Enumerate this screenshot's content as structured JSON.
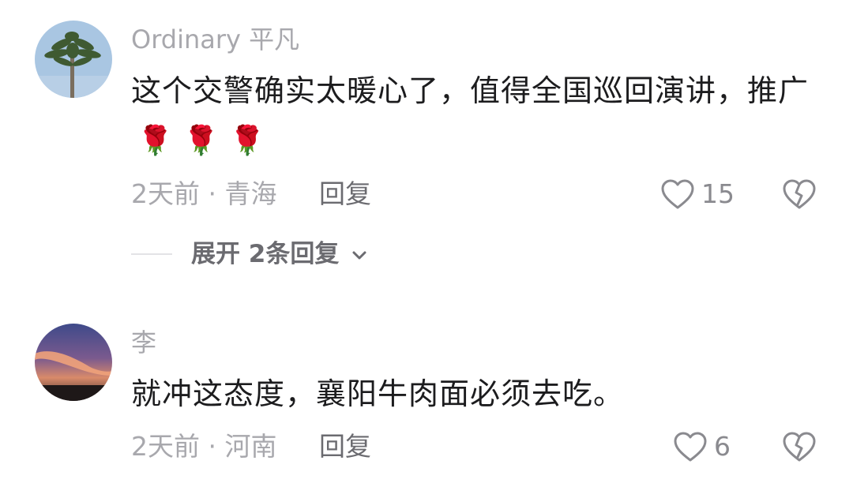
{
  "comments": [
    {
      "username": "Ordinary 平凡",
      "text": "这个交警确实太暖心了，值得全国巡回演讲，推广",
      "emoji": "🌹 🌹 🌹",
      "meta": "2天前 · 青海",
      "reply_label": "回复",
      "likes": "15",
      "expand_replies": "展开 2条回复"
    },
    {
      "username": "李",
      "text": "就冲这态度，襄阳牛肉面必须去吃。",
      "meta": "2天前 · 河南",
      "reply_label": "回复",
      "likes": "6"
    }
  ],
  "colors": {
    "text": "#1c1c1e",
    "muted": "#a8a8ad",
    "reply": "#6b6b70",
    "icon": "#8a8a8f"
  }
}
